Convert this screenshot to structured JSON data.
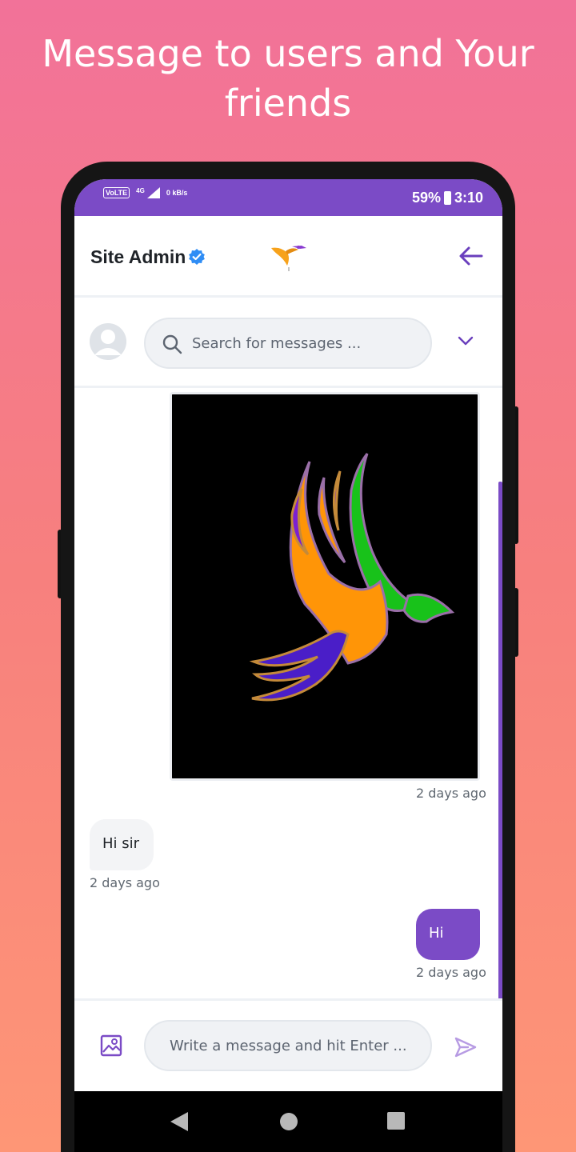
{
  "promo": {
    "headline": "Message to users and Your friends"
  },
  "status_bar": {
    "left_indicators": [
      "VoLTE",
      "4G",
      "0 kB/s"
    ],
    "battery": "59%",
    "time": "3:10"
  },
  "header": {
    "contact_name": "Site Admin",
    "verified_icon": "verified-badge-icon",
    "logo": "bird-logo",
    "back_icon": "arrow-left-icon"
  },
  "toolbar": {
    "search_placeholder": "Search for messages ...",
    "dropdown_icon": "chevron-down-icon"
  },
  "messages": [
    {
      "type": "image",
      "direction": "outgoing",
      "content": "bird-logo-image",
      "timestamp": "2 days ago"
    },
    {
      "type": "text",
      "direction": "incoming",
      "text": "Hi sir",
      "timestamp": "2 days ago"
    },
    {
      "type": "text",
      "direction": "outgoing",
      "text": "Hi",
      "timestamp": "2 days ago"
    }
  ],
  "composer": {
    "placeholder": "Write a message and hit Enter ...",
    "attach_icon": "image-attach-icon",
    "send_icon": "send-icon"
  },
  "colors": {
    "accent": "#7b4bc6",
    "bubble_in": "#f3f4f6"
  }
}
